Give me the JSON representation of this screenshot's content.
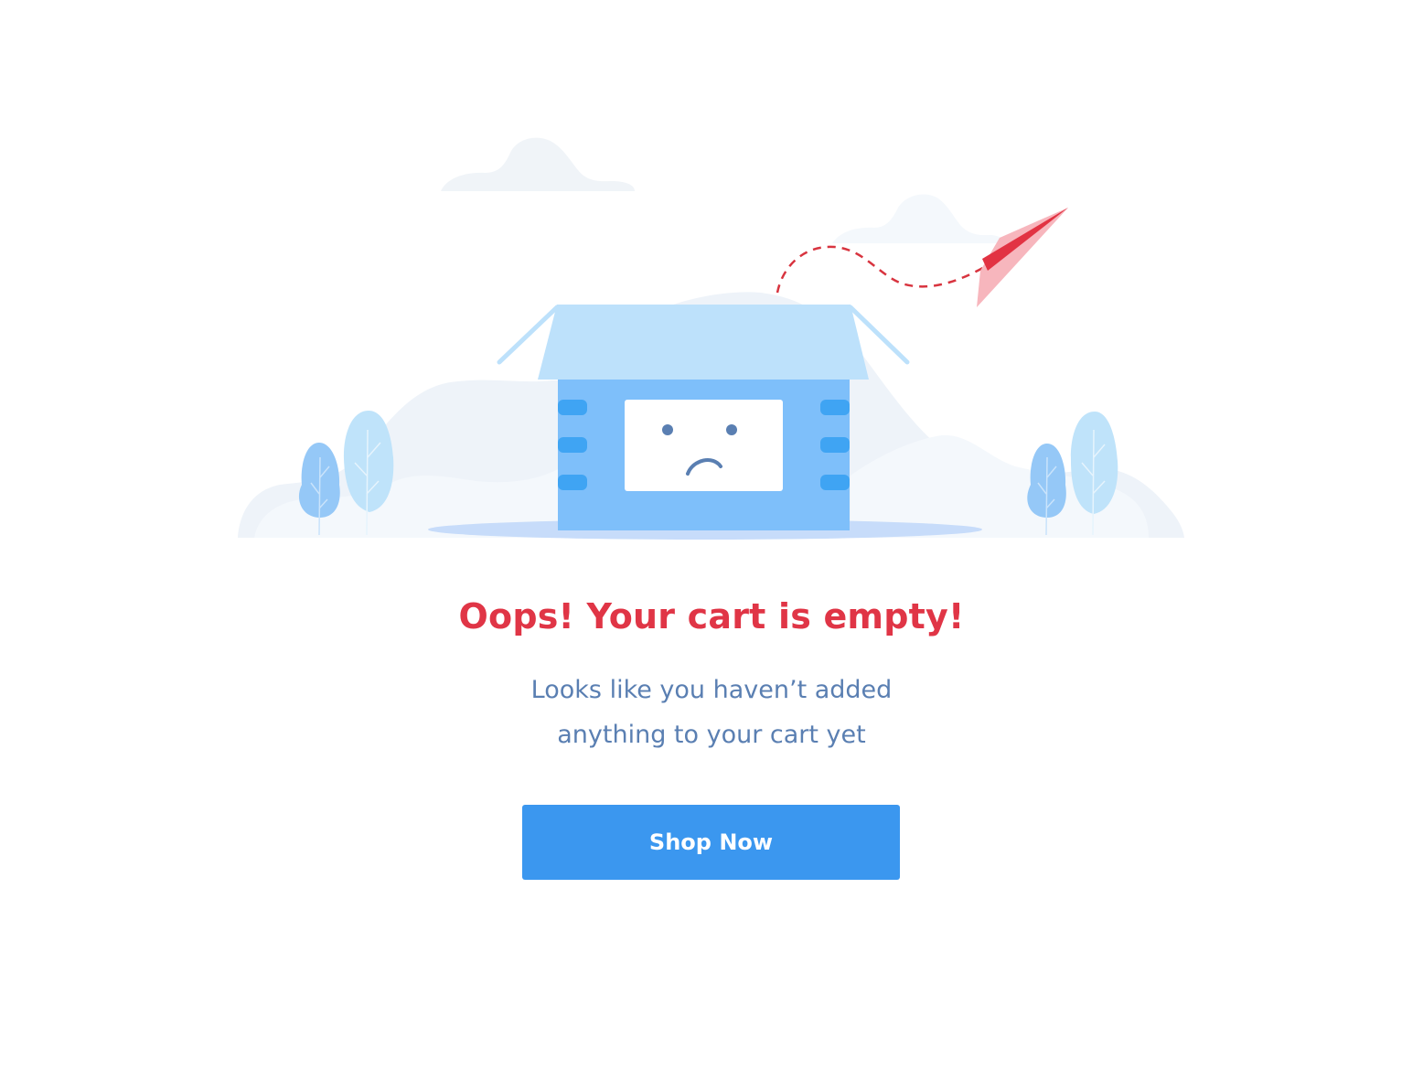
{
  "empty_cart": {
    "title": "Oops! Your cart is empty!",
    "message_line1": "Looks like you haven’t added",
    "message_line2": "anything to your cart yet",
    "button_label": "Shop Now"
  },
  "colors": {
    "title": "#e03546",
    "message": "#5a7fb2",
    "button_bg": "#3b97ef",
    "button_text": "#ffffff",
    "box_body": "#7ebffa",
    "box_lid": "#bde1fb",
    "box_handles": "#3fa4f3",
    "face": "#5a7fb2",
    "plane": "#f7b6bd",
    "plane_fold": "#e23343",
    "flight_path": "#d8343f",
    "hills": "#eef3f9",
    "clouds": "#f1f5fa",
    "shadow": "#c7dcfa",
    "tree_dark": "#95c8f7",
    "tree_light": "#bfe3fa"
  },
  "icons": {
    "illustration": "empty-box-sad-face",
    "plane": "paper-plane-icon"
  }
}
